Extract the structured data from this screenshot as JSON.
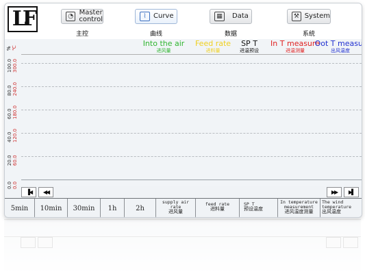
{
  "logo": {
    "text": "LF"
  },
  "nav": {
    "items": [
      {
        "label": "Master\ncontrol",
        "sub": "主控",
        "icon": "meter-icon"
      },
      {
        "label": "Curve",
        "sub": "曲线",
        "icon": "chart-icon"
      },
      {
        "label": "Data",
        "sub": "数据",
        "icon": "table-icon"
      },
      {
        "label": "System",
        "sub": "系统",
        "icon": "wrench-icon"
      }
    ]
  },
  "chart_data": {
    "type": "line",
    "y_axis_label": "%",
    "y_axis_label_2": "℃",
    "y_ticks_percent": [
      "100.0",
      "80.0",
      "60.0",
      "40.0",
      "20.0",
      "0.0"
    ],
    "y_ticks_temp": [
      "300.0",
      "240.0",
      "180.0",
      "120.0",
      "60.0",
      "0.0"
    ],
    "ylim_percent": [
      0,
      100
    ],
    "ylim_temp": [
      0,
      300
    ],
    "grid": true,
    "series": [
      {
        "name": "Into the air",
        "name_cn": "进风量",
        "color": "#2fb52f",
        "values": []
      },
      {
        "name": "Feed rate",
        "name_cn": "进料量",
        "color": "#f0d020",
        "values": []
      },
      {
        "name": "SP T",
        "name_cn": "进温预设",
        "color": "#111111",
        "values": []
      },
      {
        "name": "In T measure",
        "name_cn": "进温测量",
        "color": "#e02020",
        "values": []
      },
      {
        "name": "Oot T measur",
        "name_cn": "出风温度",
        "color": "#2030d0",
        "values": []
      }
    ]
  },
  "scroll": {
    "first": "▐◀",
    "prev": "◀◀",
    "next": "▶▶",
    "last": "▶▌"
  },
  "time_ranges": [
    "5min",
    "10min",
    "30min",
    "1h",
    "2h"
  ],
  "columns": [
    {
      "en": "supply air\nrate",
      "cn": "进风量"
    },
    {
      "en": "feed rate",
      "cn": "进料量"
    },
    {
      "en": "SP T",
      "cn": "预设温度"
    },
    {
      "en": "In temperature\nmeasurement",
      "cn": "进风温度测量"
    },
    {
      "en": "The wind\ntemperature",
      "cn": "出风温度"
    }
  ]
}
